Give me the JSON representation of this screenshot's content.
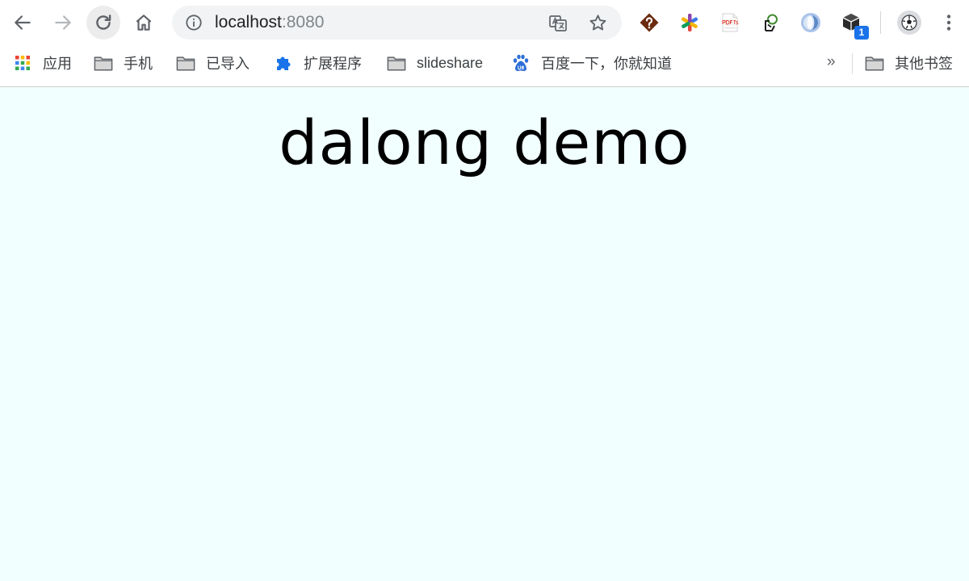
{
  "browser": {
    "address_bar": {
      "host": "localhost",
      "port": ":8080"
    },
    "extensions": [
      {
        "name": "question-mark-extension"
      },
      {
        "name": "colorful-asterisk-extension"
      },
      {
        "name": "pdf-js-extension"
      },
      {
        "name": "green-leaf-extension"
      },
      {
        "name": "blue-circle-extension"
      },
      {
        "name": "cube-extension",
        "badge": "1"
      }
    ],
    "bookmarks": {
      "items": [
        {
          "label": "应用",
          "icon": "apps-grid-icon"
        },
        {
          "label": "手机",
          "icon": "folder-icon"
        },
        {
          "label": "已导入",
          "icon": "folder-icon"
        },
        {
          "label": "扩展程序",
          "icon": "puzzle-icon"
        },
        {
          "label": "slideshare",
          "icon": "folder-icon"
        },
        {
          "label": "百度一下，你就知道",
          "icon": "baidu-paw-icon"
        }
      ],
      "overflow": "»",
      "other": {
        "label": "其他书签",
        "icon": "folder-icon"
      }
    }
  },
  "page": {
    "heading": "dalong demo",
    "background": "#f1ffff"
  },
  "colors": {
    "badge": "#1a73e8",
    "omnibox_bg": "#f1f3f4"
  }
}
